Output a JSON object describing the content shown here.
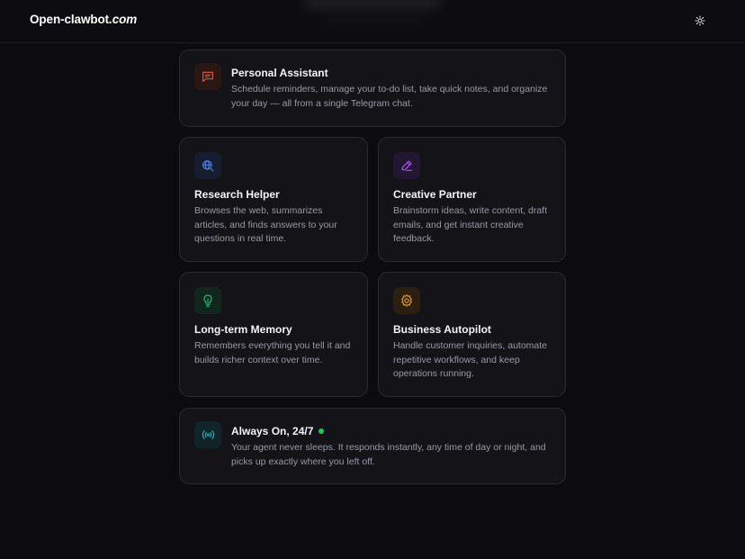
{
  "header": {
    "logo_name": "Open-clawbot",
    "logo_tld": ".com",
    "theme_toggle_icon": "sun-icon"
  },
  "colors": {
    "background": "#0c0c10",
    "card": "#131318",
    "card_border": "#2a2a32",
    "status_online": "#22c55e"
  },
  "features": {
    "personal": {
      "title": "Personal Assistant",
      "description": "Schedule reminders, manage your to-do list, take quick notes, and organize your day — all from a single Telegram chat.",
      "icon": "chat-icon",
      "accent": "#e5533d"
    },
    "research": {
      "title": "Research Helper",
      "description": "Browses the web, summarizes articles, and finds answers to your questions in real time.",
      "icon": "globe-search-icon",
      "accent": "#4f7fe6"
    },
    "creative": {
      "title": "Creative Partner",
      "description": "Brainstorm ideas, write content, draft emails, and get instant creative feedback.",
      "icon": "pencil-icon",
      "accent": "#a855f7"
    },
    "memory": {
      "title": "Long-term Memory",
      "description": "Remembers everything you tell it and builds richer context over time.",
      "icon": "lightbulb-icon",
      "accent": "#2fb37a"
    },
    "business": {
      "title": "Business Autopilot",
      "description": "Handle customer inquiries, automate repetitive workflows, and keep operations running.",
      "icon": "gear-icon",
      "accent": "#e39a1c"
    },
    "always_on": {
      "title": "Always On, 24/7",
      "description": "Your agent never sleeps. It responds instantly, any time of day or night, and picks up exactly where you left off.",
      "icon": "broadcast-icon",
      "accent": "#2aa7b8"
    }
  }
}
